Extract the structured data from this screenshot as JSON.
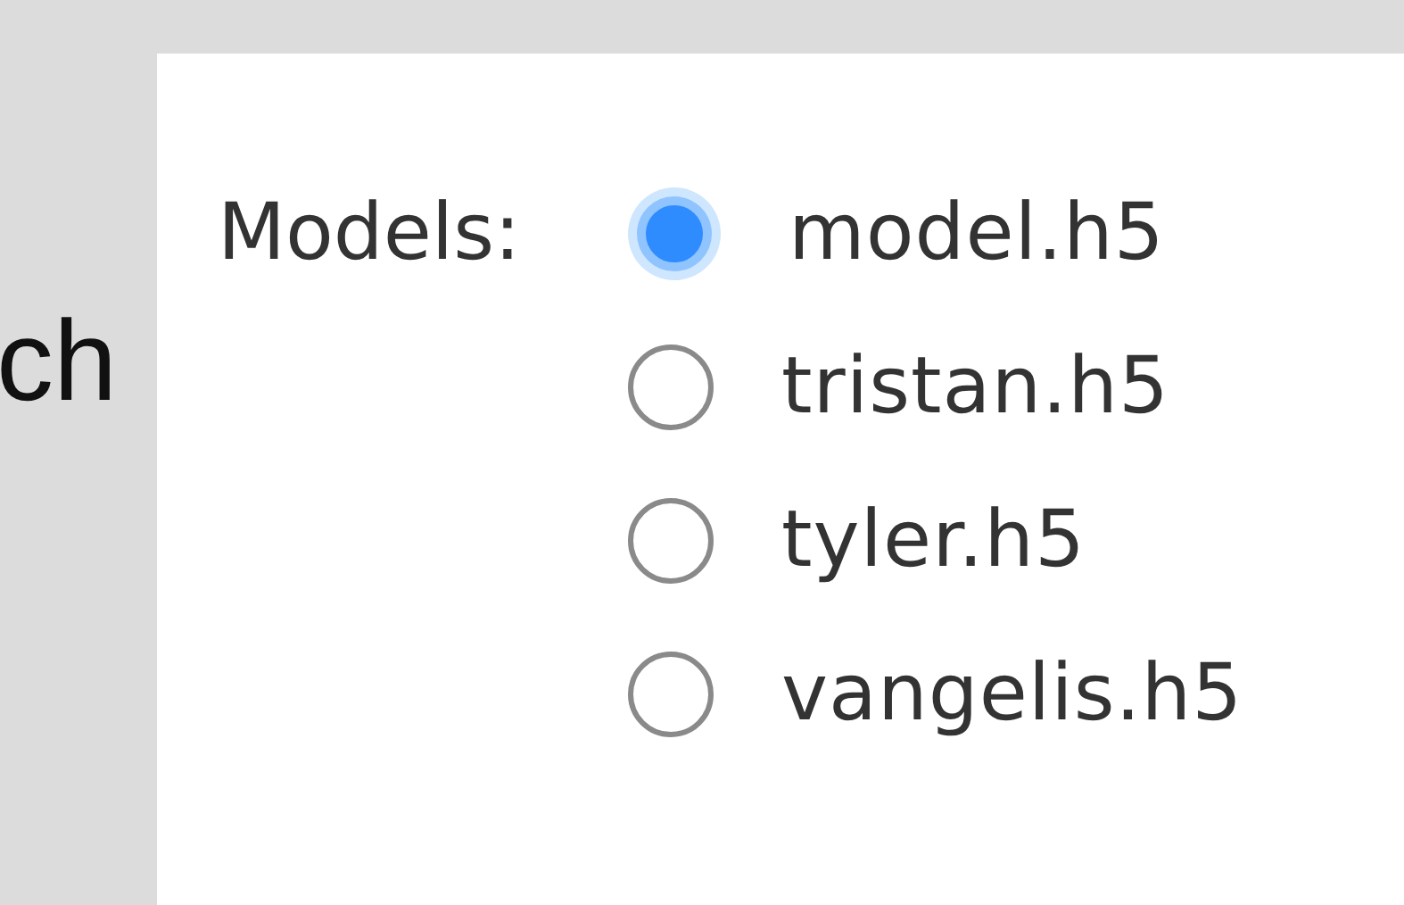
{
  "background_text": "ch",
  "models": {
    "label": "Models:",
    "options": [
      {
        "label": "model.h5",
        "selected": true
      },
      {
        "label": "tristan.h5",
        "selected": false
      },
      {
        "label": "tyler.h5",
        "selected": false
      },
      {
        "label": "vangelis.h5",
        "selected": false
      }
    ]
  }
}
